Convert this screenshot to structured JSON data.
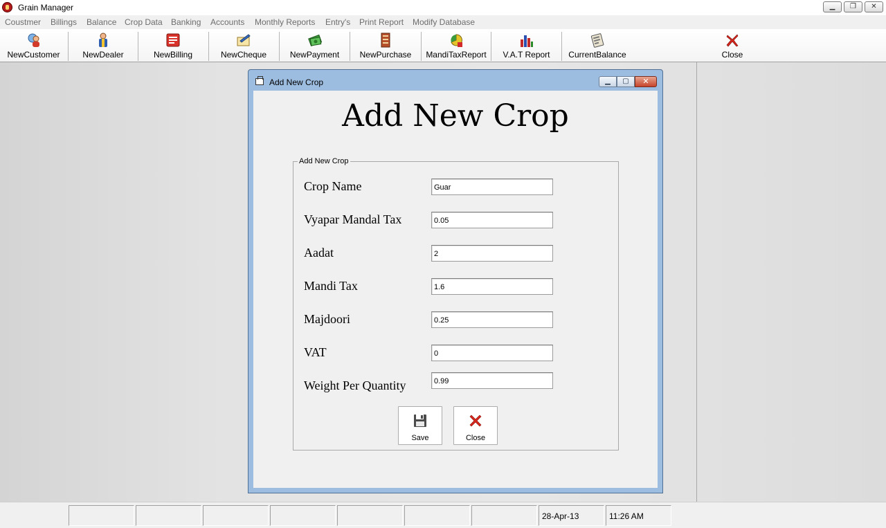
{
  "app": {
    "title": "Grain Manager",
    "window_buttons": [
      "minimize",
      "restore",
      "close"
    ]
  },
  "menu": [
    {
      "label": "Coustmer"
    },
    {
      "label": "Billings"
    },
    {
      "label": "Balance"
    },
    {
      "label": "Crop Data"
    },
    {
      "label": "Banking"
    },
    {
      "label": "Accounts"
    },
    {
      "label": "Monthly Reports"
    },
    {
      "label": "Entry's"
    },
    {
      "label": "Print Report"
    },
    {
      "label": "Modify Database"
    }
  ],
  "toolbar": [
    {
      "label": "NewCustomer",
      "icon": "customer-icon"
    },
    {
      "label": "NewDealer",
      "icon": "dealer-icon"
    },
    {
      "label": "NewBilling",
      "icon": "billing-icon"
    },
    {
      "label": "NewCheque",
      "icon": "cheque-icon"
    },
    {
      "label": "NewPayment",
      "icon": "payment-icon"
    },
    {
      "label": "NewPurchase",
      "icon": "purchase-icon"
    },
    {
      "label": "MandiTaxReport",
      "icon": "report-icon"
    },
    {
      "label": "V.A.T Report",
      "icon": "vat-report-icon"
    },
    {
      "label": "CurrentBalance",
      "icon": "balance-icon"
    },
    {
      "label": "Close",
      "icon": "close-icon"
    }
  ],
  "dialog": {
    "title": "Add New Crop",
    "heading": "Add New Crop",
    "group_label": "Add New Crop",
    "fields": [
      {
        "label": "Crop Name",
        "value": "Guar"
      },
      {
        "label": "Vyapar Mandal Tax",
        "value": "0.05"
      },
      {
        "label": "Aadat",
        "value": "2"
      },
      {
        "label": "Mandi Tax",
        "value": "1.6"
      },
      {
        "label": "Majdoori",
        "value": "0.25"
      },
      {
        "label": "VAT",
        "value": "0"
      },
      {
        "label": "Weight Per Quantity",
        "value": "0.99"
      }
    ],
    "save_label": "Save",
    "close_label": "Close"
  },
  "status": {
    "date": "28-Apr-13",
    "time": "11:26 AM"
  },
  "colors": {
    "dialog_frame": "#9dbde0",
    "close_red": "#d8261c",
    "menu_text": "#6d6d6d"
  }
}
